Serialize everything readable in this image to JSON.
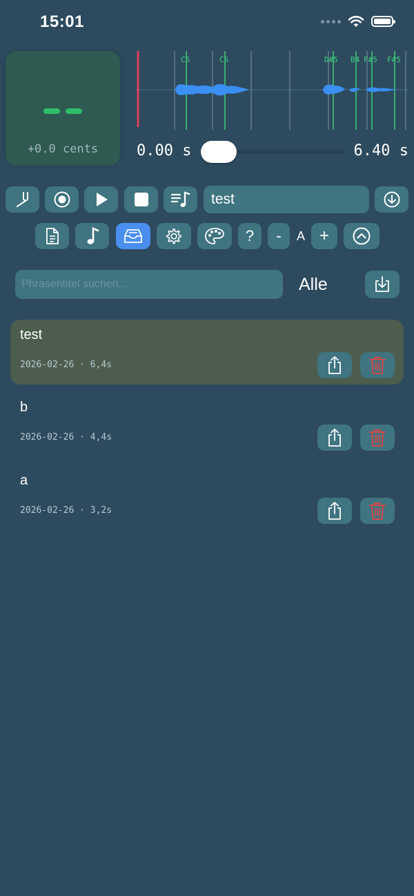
{
  "status_bar": {
    "time": "15:01"
  },
  "tuner": {
    "note": "– –",
    "cents": "+0.0 cents",
    "note_color": "#2fbf6a"
  },
  "waveform": {
    "note_labels": [
      "C5",
      "C5",
      "D#5",
      "B4",
      "F#5",
      "F#5"
    ],
    "marker_color": "#3fcf7a",
    "playhead_color": "#e0405a",
    "wave_color": "#3a8ff2"
  },
  "playback": {
    "start_time": "0.00 s",
    "end_time": "6.40 s",
    "position": 0.0
  },
  "toolbar": {
    "row1": [
      "tuning-fork-icon",
      "record-icon",
      "play-icon",
      "stop-icon",
      "playlist-icon"
    ],
    "title_value": "test",
    "download": "download-circle-icon",
    "row2": [
      "document-icon",
      "note-icon",
      "inbox-icon",
      "gear-icon",
      "palette-icon"
    ],
    "help_label": "?",
    "minus_label": "-",
    "font_label": "A",
    "plus_label": "+",
    "collapse": "chevron-up-circle-icon"
  },
  "search": {
    "placeholder": "Phrasentitel suchen...",
    "value": "",
    "filter_label": "Alle"
  },
  "phrases": [
    {
      "title": "test",
      "meta": "2026-02-26 · 6,4s",
      "selected": true
    },
    {
      "title": "b",
      "meta": "2026-02-26 · 4,4s",
      "selected": false
    },
    {
      "title": "a",
      "meta": "2026-02-26 · 3,2s",
      "selected": false
    }
  ],
  "colors": {
    "background": "#2d4a5e",
    "button": "#3f7480",
    "active_button": "#4a8ef0",
    "delete": "#d24a4a",
    "selected_card": "#4c5d4e"
  }
}
